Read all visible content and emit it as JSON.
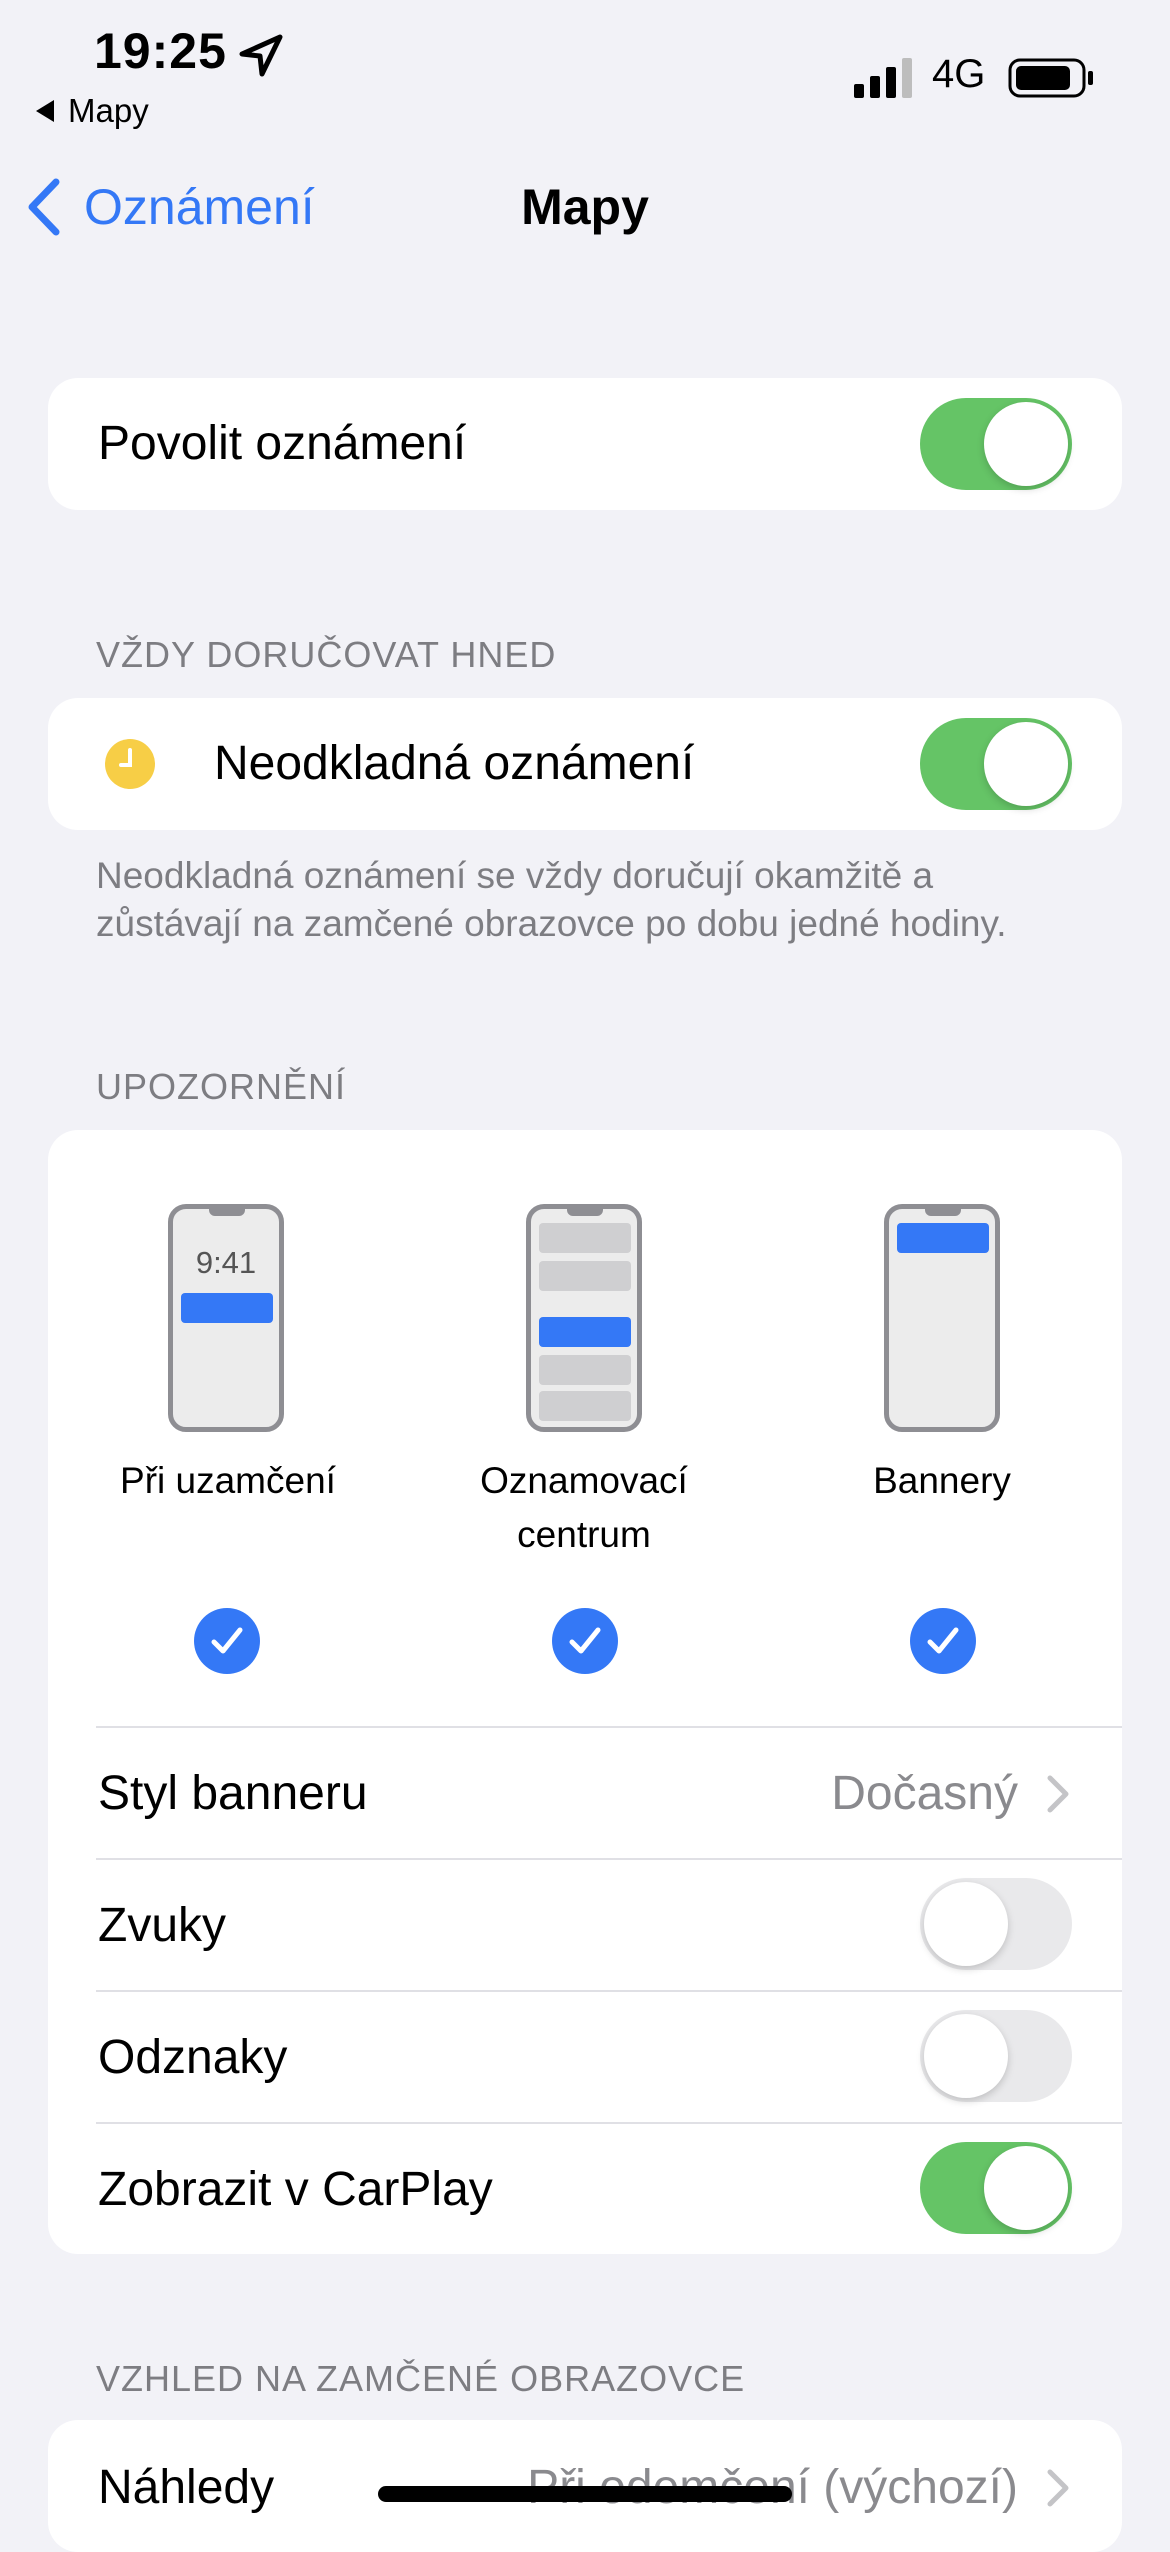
{
  "status_bar": {
    "time": "19:25",
    "back_app": "Mapy",
    "network": "4G"
  },
  "nav": {
    "back_label": "Oznámení",
    "title": "Mapy"
  },
  "allow": {
    "label": "Povolit oznámení",
    "enabled": true
  },
  "deliver_section": {
    "header": "VŽDY DORUČOVAT HNED",
    "urgent_label": "Neodkladná oznámení",
    "urgent_enabled": true,
    "footer": "Neodkladná oznámení se vždy doručují okamžitě a zůstávají na zamčené obrazovce po dobu jedné hodiny."
  },
  "alerts_section": {
    "header": "UPOZORNĚNÍ",
    "options": [
      {
        "label": "Při uzamčení",
        "preview_time": "9:41",
        "checked": true
      },
      {
        "label": "Oznamovací centrum",
        "checked": true
      },
      {
        "label": "Bannery",
        "checked": true
      }
    ],
    "banner_style": {
      "label": "Styl banneru",
      "value": "Dočasný"
    },
    "sounds": {
      "label": "Zvuky",
      "enabled": false
    },
    "badges": {
      "label": "Odznaky",
      "enabled": false
    },
    "carplay": {
      "label": "Zobrazit v CarPlay",
      "enabled": true
    }
  },
  "lockscreen_section": {
    "header": "VZHLED NA ZAMČENÉ OBRAZOVCE",
    "previews": {
      "label": "Náhledy",
      "value": "Při odemčení (výchozí)"
    }
  },
  "colors": {
    "accent": "#3478f6",
    "toggle_on": "#65c466",
    "background": "#f2f2f7",
    "urgent_icon": "#f7ce46"
  }
}
